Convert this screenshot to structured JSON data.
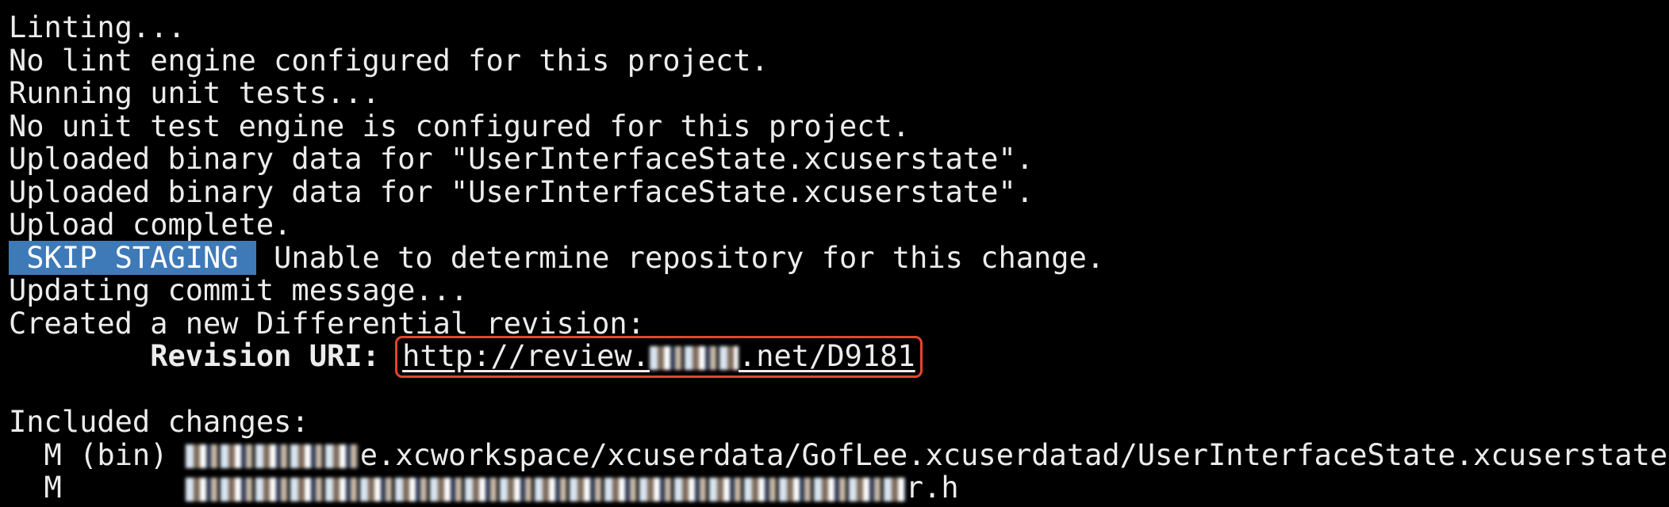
{
  "terminal": {
    "lines": [
      "Linting...",
      "No lint engine configured for this project.",
      "Running unit tests...",
      "No unit test engine is configured for this project.",
      "Uploaded binary data for \"UserInterfaceState.xcuserstate\".",
      "Uploaded binary data for \"UserInterfaceState.xcuserstate\".",
      "Upload complete."
    ],
    "skip_badge": " SKIP STAGING ",
    "skip_message": " Unable to determine repository for this change.",
    "updating": "Updating commit message...",
    "created": "Created a new Differential revision:",
    "revision_label": "        Revision URI:",
    "url_prefix": "http://review.",
    "url_suffix": ".net/D9181",
    "included": "Included changes:",
    "change1_prefix": "  M (bin) ",
    "change1_suffix": "e.xcworkspace/xcuserdata/GofLee.xcuserdatad/UserInterfaceState.xcuserstate",
    "change2_prefix": "  M       ",
    "change2_suffix": "r.h"
  },
  "colors": {
    "badge": "#3f7ab8",
    "highlight_box": "#e8442c",
    "background": "#000000"
  }
}
